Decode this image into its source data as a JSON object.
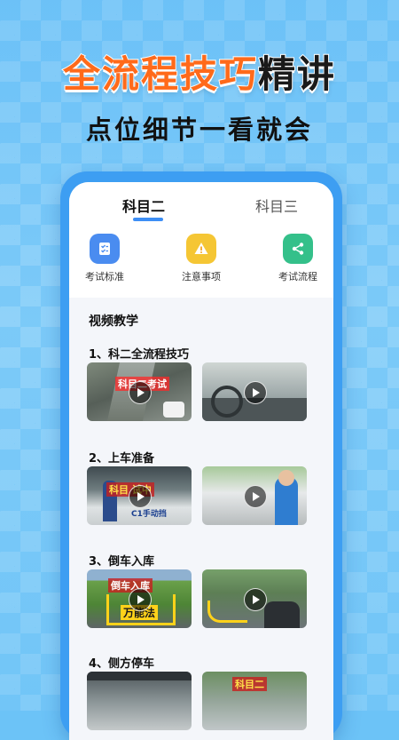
{
  "headline": {
    "part_orange": "全流程技巧",
    "part_dark": "精讲"
  },
  "subheadline": "点位细节一看就会",
  "tabs": [
    {
      "label": "科目二",
      "active": true
    },
    {
      "label": "科目三",
      "active": false
    }
  ],
  "quick_actions": [
    {
      "label": "考试标准",
      "icon": "checklist-icon",
      "color": "#4a8cf0"
    },
    {
      "label": "注意事项",
      "icon": "warning-icon",
      "color": "#f5c634"
    },
    {
      "label": "考试流程",
      "icon": "share-icon",
      "color": "#34c08a"
    }
  ],
  "section_title": "视频教学",
  "lessons": [
    {
      "title": "1、科二全流程技巧",
      "thumb_texts": [
        "科目二考试",
        ""
      ]
    },
    {
      "title": "2、上车准备",
      "thumb_texts": [
        "科目 试中",
        "C1手动挡"
      ]
    },
    {
      "title": "3、倒车入库",
      "thumb_texts": [
        "倒车入库",
        "万能法"
      ]
    },
    {
      "title": "4、侧方停车",
      "thumb_texts": [
        "",
        "科目二"
      ]
    }
  ],
  "colors": {
    "accent": "#3d8ef5",
    "headline_orange": "#ff6a1a",
    "phone_frame": "#3d9ef2"
  }
}
